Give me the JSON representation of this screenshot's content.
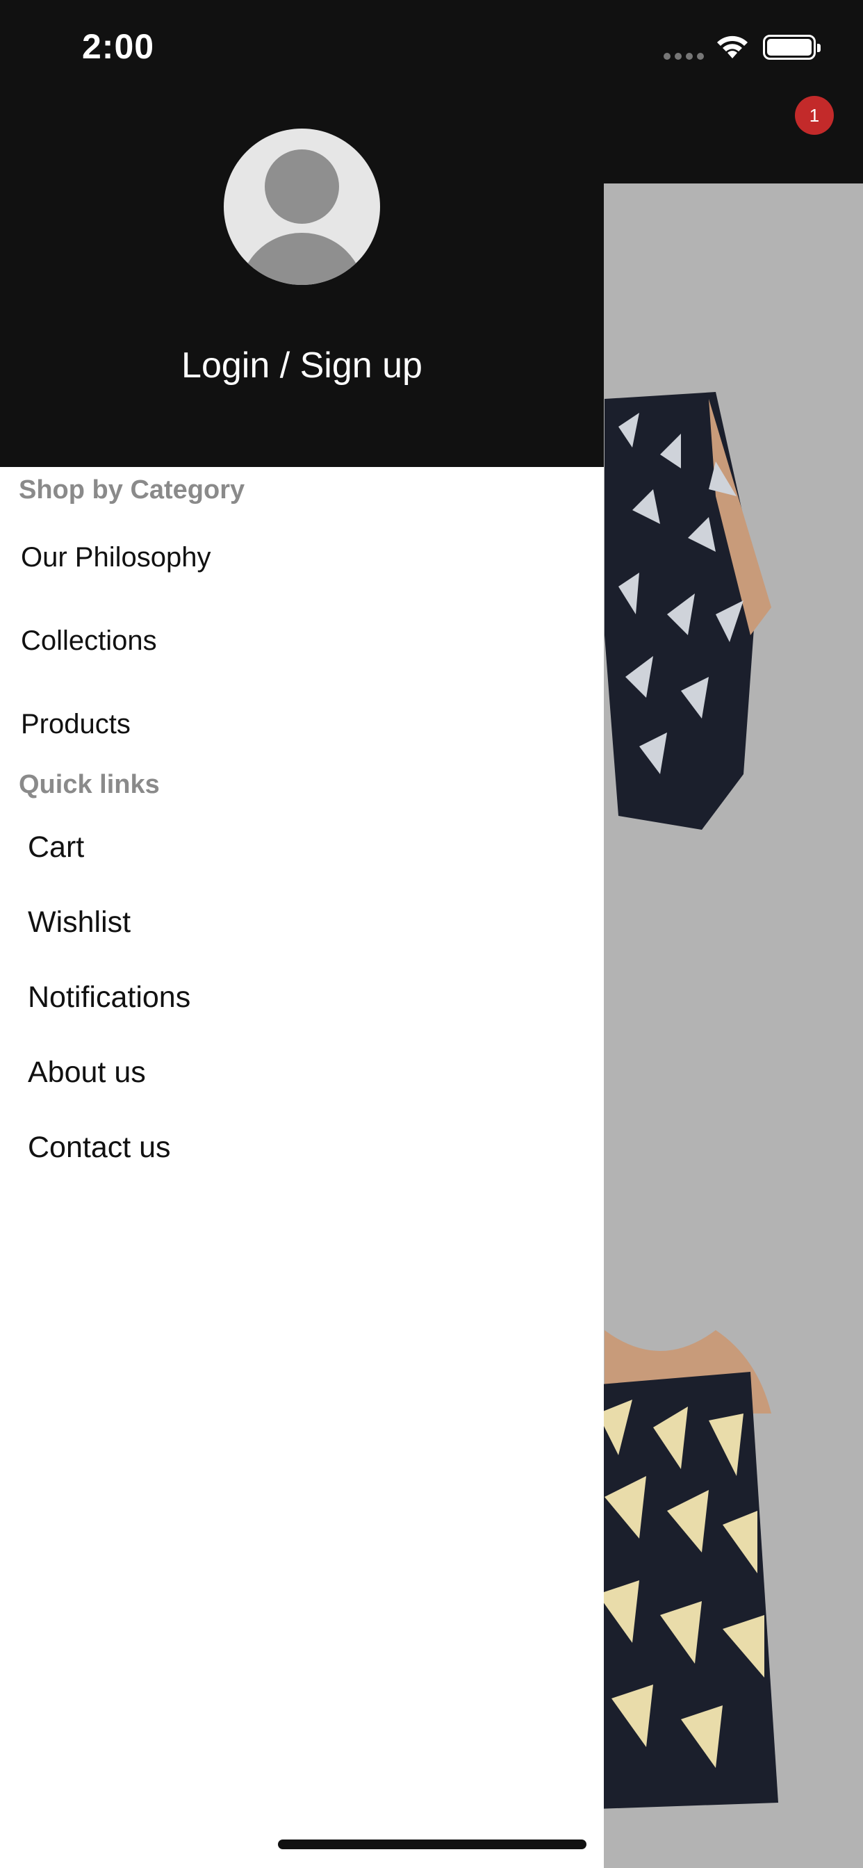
{
  "status_bar": {
    "time": "2:00"
  },
  "header": {
    "cart_badge_count": "1"
  },
  "drawer": {
    "login_label": "Login / Sign up",
    "shop_by_category": {
      "title": "Shop by Category",
      "items": [
        "Our Philosophy",
        "Collections",
        "Products"
      ]
    },
    "quick_links": {
      "title": "Quick links",
      "items": [
        "Cart",
        "Wishlist",
        "Notifications",
        "About us",
        "Contact us"
      ]
    }
  },
  "colors": {
    "header_bg": "#111111",
    "drawer_bg": "#ffffff",
    "section_title": "#8a8a8a",
    "badge": "#c32a2a",
    "overlay": "#b3b3b3"
  }
}
